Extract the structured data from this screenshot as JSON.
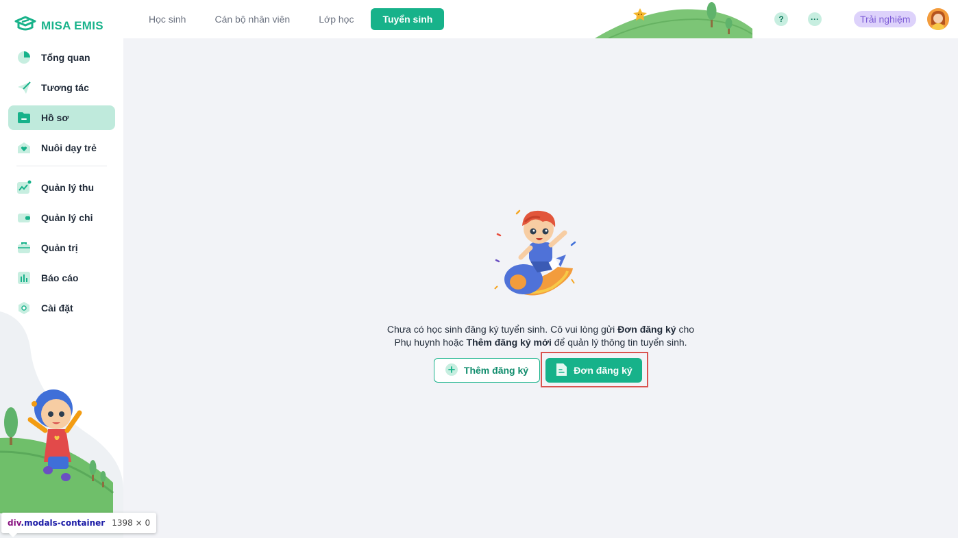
{
  "app": {
    "logo_text": "MISA EMIS"
  },
  "sidebar": {
    "items": [
      {
        "label": "Tổng quan",
        "icon": "pie-chart-icon"
      },
      {
        "label": "Tương tác",
        "icon": "paper-plane-icon"
      },
      {
        "label": "Hồ sơ",
        "icon": "folder-icon",
        "active": true
      },
      {
        "label": "Nuôi dạy trẻ",
        "icon": "heart-house-icon"
      },
      {
        "label": "Quản lý thu",
        "icon": "trend-up-icon"
      },
      {
        "label": "Quản lý chi",
        "icon": "wallet-icon"
      },
      {
        "label": "Quản trị",
        "icon": "briefcase-icon"
      },
      {
        "label": "Báo cáo",
        "icon": "bar-chart-icon"
      },
      {
        "label": "Cài đặt",
        "icon": "settings-icon"
      }
    ]
  },
  "header": {
    "tabs": [
      {
        "label": "Học sinh"
      },
      {
        "label": "Cán bộ nhân viên"
      },
      {
        "label": "Lớp học"
      },
      {
        "label": "Tuyển sinh",
        "active": true
      }
    ],
    "help_label": "?",
    "more_label": "···",
    "trial_label": "Trải nghiệm"
  },
  "empty_state": {
    "line1_pre": "Chưa có học sinh đăng ký tuyển sinh. Cô vui lòng gửi ",
    "line1_bold": "Đơn đăng ký",
    "line1_post": " cho",
    "line2_pre": "Phụ huynh hoặc ",
    "line2_bold": "Thêm đăng ký mới",
    "line2_post": " để quản lý thông tin tuyển sinh.",
    "add_button_label": "Thêm đăng ký",
    "form_button_label": "Đơn đăng ký"
  },
  "devtools_tooltip": {
    "tag": "div",
    "class": ".modals-container",
    "size": "1398 × 0"
  },
  "colors": {
    "brand": "#17b28a",
    "active_nav_bg": "#bfeadc",
    "trial_bg": "#ddd2fb",
    "highlight": "#d9534f"
  }
}
